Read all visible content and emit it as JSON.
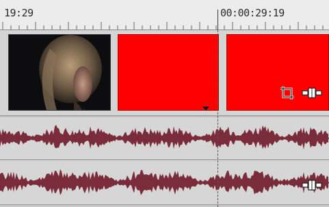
{
  "timeline": {
    "ruler": {
      "left_time": "19:29",
      "right_time": "00:00:29:19"
    }
  },
  "video_track": {
    "clips": [
      {
        "kind": "video-thumbnail",
        "description_color": "#0e0e10"
      },
      {
        "kind": "solid-color",
        "color": "#ff0000"
      },
      {
        "kind": "solid-color",
        "color": "#ff0000"
      }
    ],
    "icons": [
      "crop-icon",
      "pan-crop-event-icon"
    ]
  },
  "audio_tracks": [
    {
      "waveform_color": "#7a2c3a",
      "icons": []
    },
    {
      "waveform_color": "#7a2c3a",
      "icons": [
        "pan-crop-event-icon"
      ]
    }
  ],
  "colors": {
    "background": "#c8c8c8",
    "ruler_bg": "#ececec",
    "clip_red": "#ff0000",
    "waveform": "#7a2c3a"
  }
}
